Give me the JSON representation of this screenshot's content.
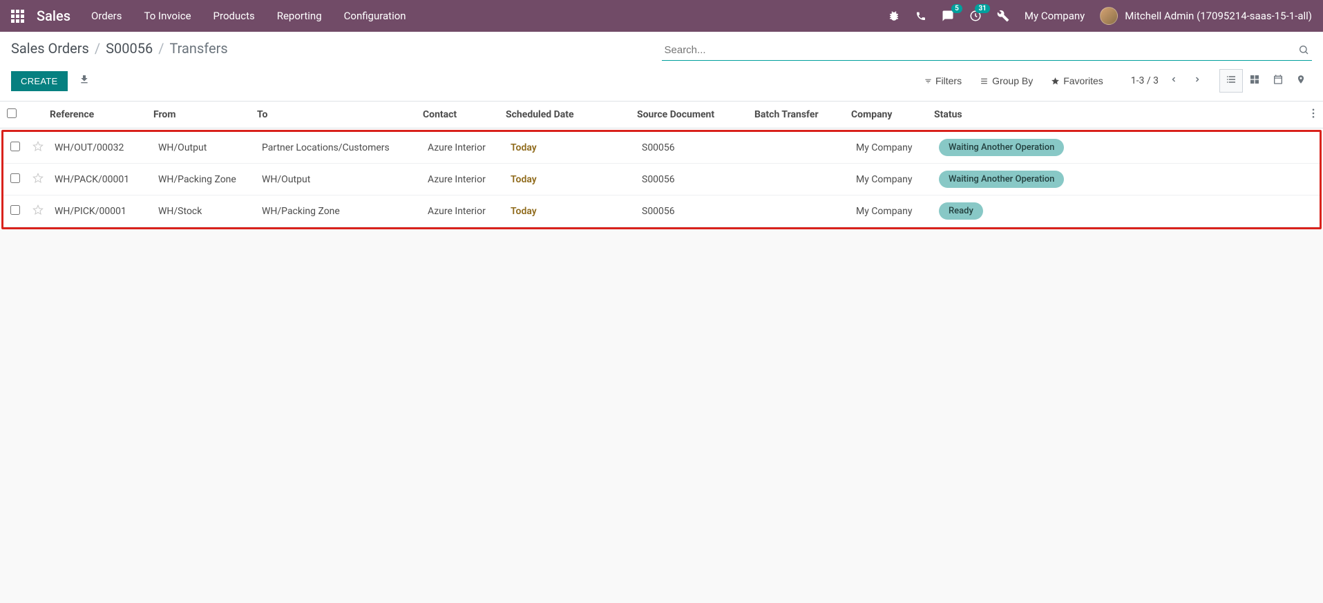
{
  "navbar": {
    "brand": "Sales",
    "menu": [
      "Orders",
      "To Invoice",
      "Products",
      "Reporting",
      "Configuration"
    ],
    "messages_badge": "5",
    "activities_badge": "31",
    "company": "My Company",
    "user": "Mitchell Admin (17095214-saas-15-1-all)"
  },
  "breadcrumb": {
    "parts": [
      "Sales Orders",
      "S00056",
      "Transfers"
    ]
  },
  "search": {
    "placeholder": "Search..."
  },
  "buttons": {
    "create": "CREATE",
    "filters": "Filters",
    "group_by": "Group By",
    "favorites": "Favorites"
  },
  "pager": {
    "range": "1-3 / 3"
  },
  "columns": [
    "Reference",
    "From",
    "To",
    "Contact",
    "Scheduled Date",
    "Source Document",
    "Batch Transfer",
    "Company",
    "Status"
  ],
  "rows": [
    {
      "reference": "WH/OUT/00032",
      "from": "WH/Output",
      "to": "Partner Locations/Customers",
      "contact": "Azure Interior",
      "scheduled": "Today",
      "source": "S00056",
      "batch": "",
      "company": "My Company",
      "status": "Waiting Another Operation",
      "status_class": "status-waiting"
    },
    {
      "reference": "WH/PACK/00001",
      "from": "WH/Packing Zone",
      "to": "WH/Output",
      "contact": "Azure Interior",
      "scheduled": "Today",
      "source": "S00056",
      "batch": "",
      "company": "My Company",
      "status": "Waiting Another Operation",
      "status_class": "status-waiting"
    },
    {
      "reference": "WH/PICK/00001",
      "from": "WH/Stock",
      "to": "WH/Packing Zone",
      "contact": "Azure Interior",
      "scheduled": "Today",
      "source": "S00056",
      "batch": "",
      "company": "My Company",
      "status": "Ready",
      "status_class": "status-ready"
    }
  ]
}
